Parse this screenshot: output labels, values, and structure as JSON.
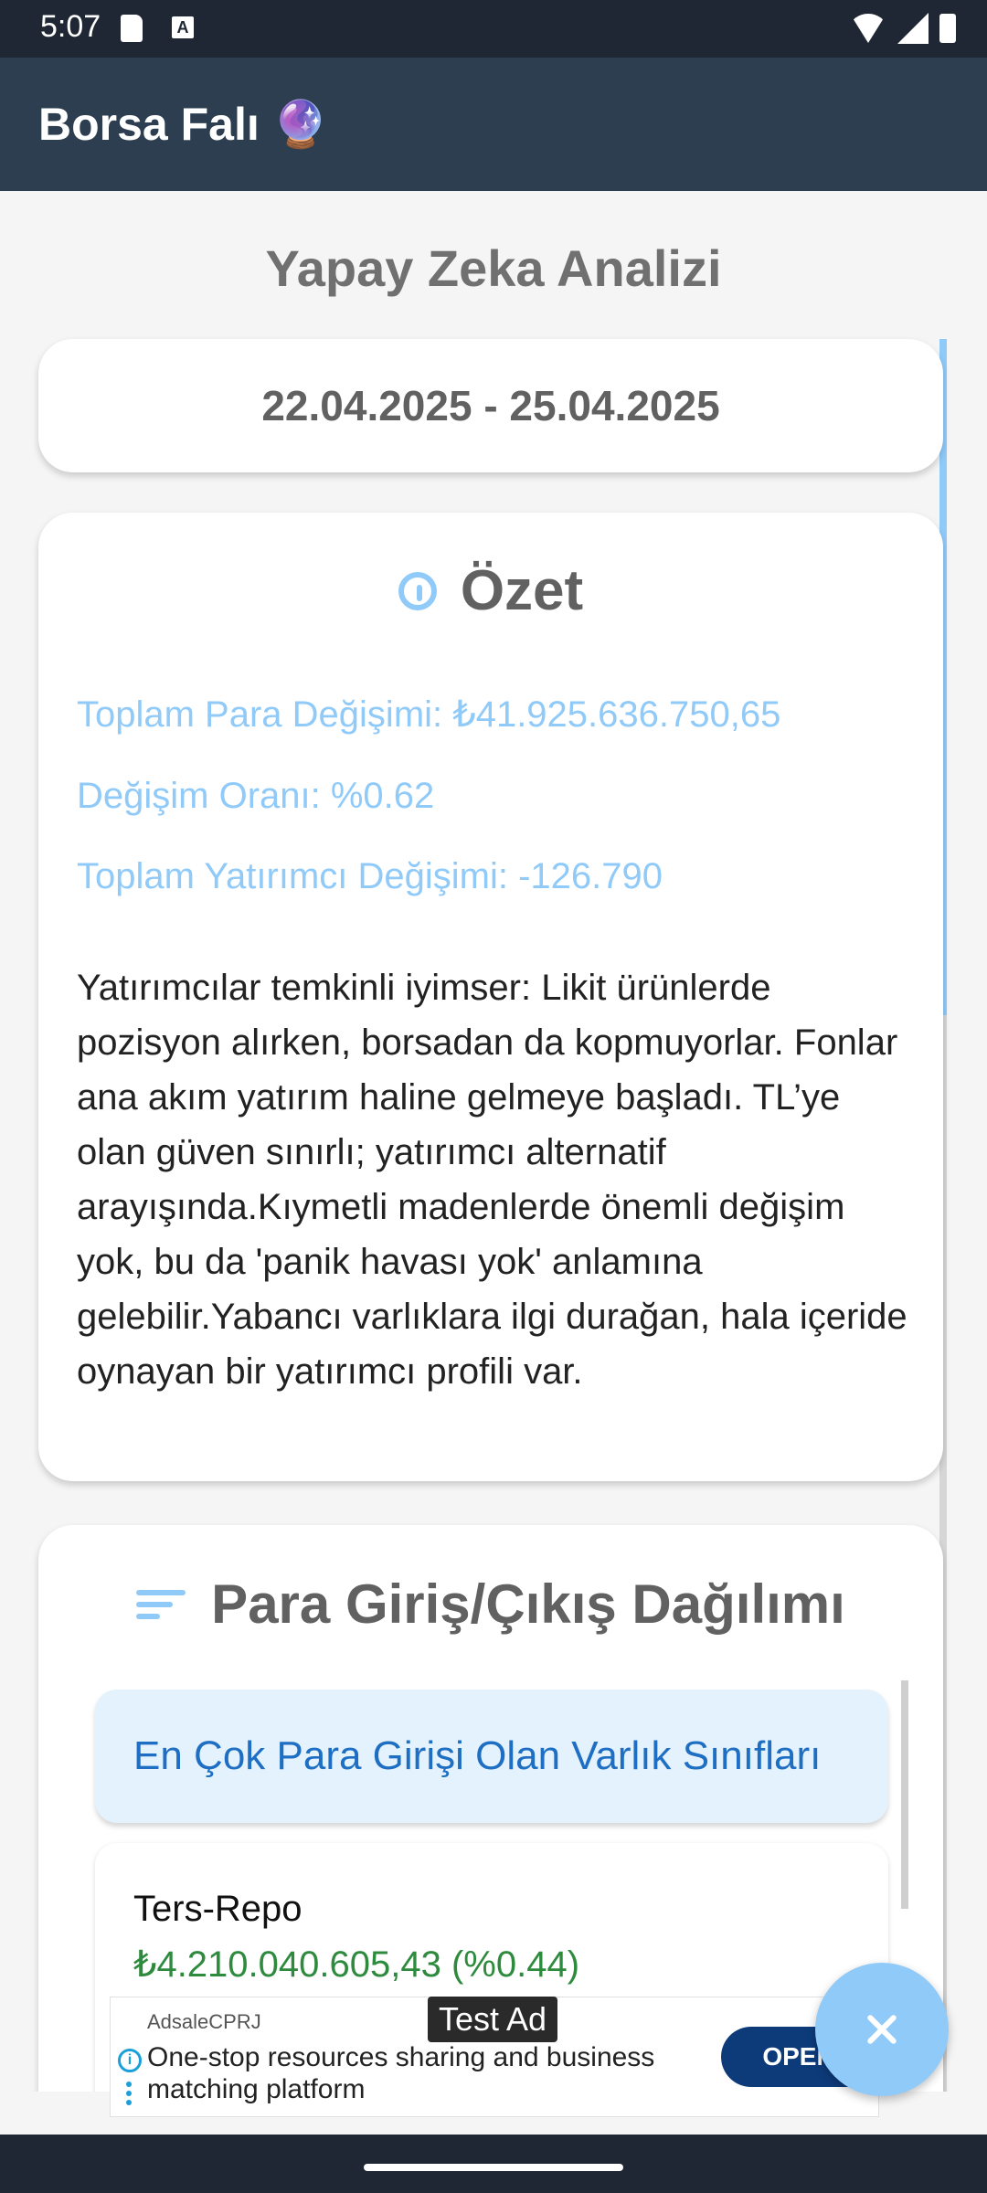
{
  "status_bar": {
    "time": "5:07",
    "a_badge": "A",
    "icons": [
      "sd-card-icon",
      "a-badge-icon",
      "wifi-icon",
      "signal-icon",
      "battery-icon"
    ]
  },
  "app_bar": {
    "title": "Borsa Falı 🔮"
  },
  "page": {
    "heading": "Yapay Zeka Analizi"
  },
  "date_range": "22.04.2025 - 25.04.2025",
  "summary": {
    "title": "Özet",
    "total_money_change": "Toplam Para Değişimi: ₺41.925.636.750,65",
    "change_rate": "Değişim Oranı: %0.62",
    "total_investor_change": "Toplam Yatırımcı Değişimi: -126.790",
    "text": "Yatırımcılar temkinli iyimser: Likit ürünlerde pozisyon alırken, borsadan da kopmuyorlar. Fonlar ana akım yatırım haline gelmeye başladı. TL’ye olan güven sınırlı; yatırımcı alternatif arayışında.Kıymetli madenlerde önemli değişim yok, bu da 'panik havası yok' anlamına gelebilir.Yabancı varlıklara ilgi durağan, hala içeride oynayan bir yatırımcı profili var."
  },
  "flow": {
    "title": "Para Giriş/Çıkış Dağılımı",
    "tab_label": "En Çok Para Girişi Olan Varlık Sınıfları",
    "items": [
      {
        "name": "Ters-Repo",
        "value": "₺4.210.040.605,43 (%0.44)"
      }
    ]
  },
  "ad": {
    "label": "Test Ad",
    "source": "AdsaleCPRJ",
    "text": "One-stop resources sharing and business matching platform",
    "cta": "OPEN"
  },
  "colors": {
    "app_bar": "#2c3e50",
    "accent_light_blue": "#90caf9",
    "positive_green": "#2e8b3e",
    "link_blue": "#1e6fc4"
  }
}
